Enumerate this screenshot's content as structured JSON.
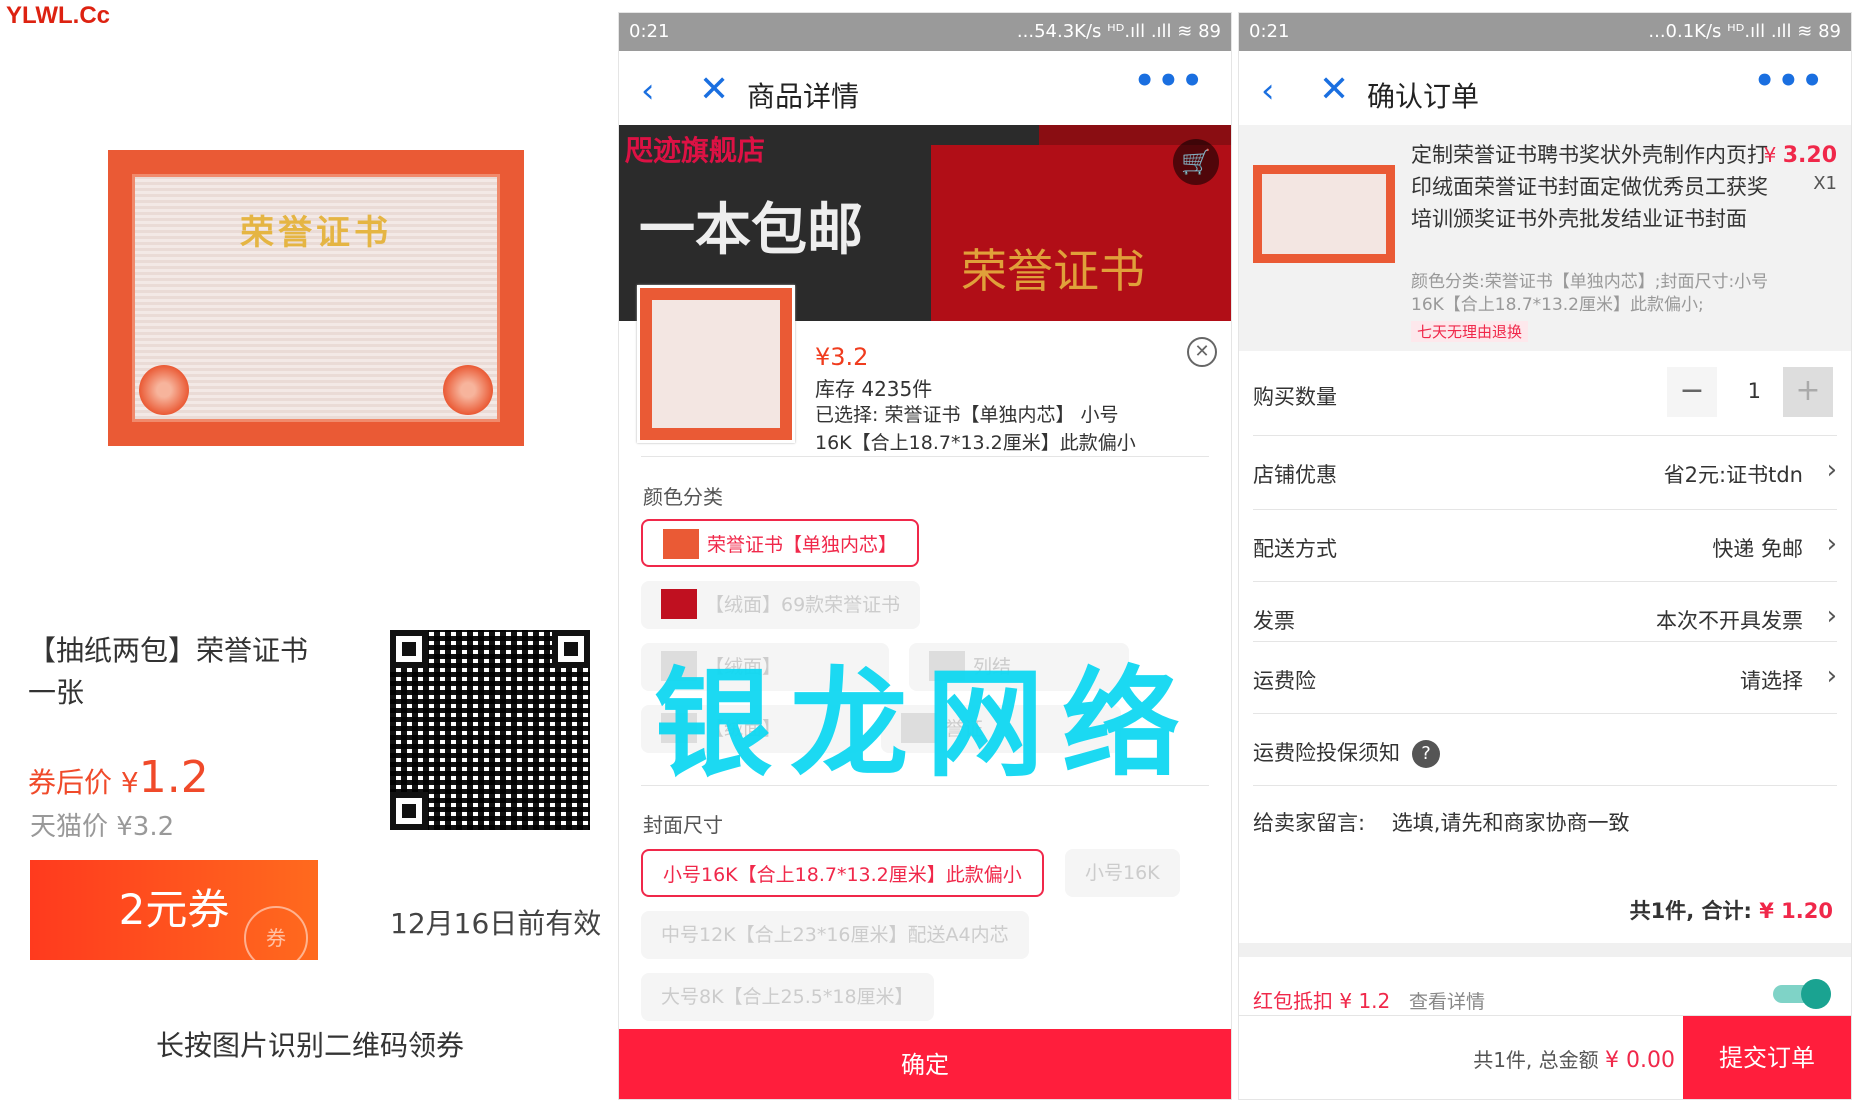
{
  "left": {
    "site_logo": "YLWL.Cc",
    "cert_title": "荣誉证书",
    "product_title": "【抽纸两包】荣誉证书一张",
    "after_price_label": "券后价 ¥",
    "after_price_value": "1.2",
    "tmall_price": "天猫价 ¥3.2",
    "coupon_label": "2元券",
    "coupon_stamp": "券",
    "valid_until": "12月16日前有效",
    "hint": "长按图片识别二维码领券"
  },
  "middle": {
    "status_time": "0:21",
    "status_right": "...54.3K/s ᴴᴰ.ıll .ıll ≋ 89",
    "nav_back": "‹",
    "nav_close": "✕",
    "nav_title": "商品详情",
    "nav_more": "•••",
    "banner_text1": "咫迹旗舰店",
    "banner_text2": "一本包邮",
    "banner_cert": "荣誉证书",
    "cart_icon": "🛒",
    "sku_price": "¥3.2",
    "sku_stock": "库存 4235件",
    "sku_selected": "已选择: 荣誉证书【单独内芯】 小号16K【合上18.7*13.2厘米】此款偏小",
    "sku_close": "✕",
    "color_section": "颜色分类",
    "color_options": [
      "荣誉证书【单独内芯】",
      "【绒面】69款荣誉证书",
      "【绒面】",
      "列结",
      "【绒面】",
      "誉证"
    ],
    "size_section": "封面尺寸",
    "size_options": [
      "小号16K【合上18.7*13.2厘米】此款偏小",
      "小号16K",
      "中号12K【合上23*16厘米】配送A4内芯",
      "大号8K【合上25.5*18厘米】"
    ],
    "confirm": "确定"
  },
  "right": {
    "status_time": "0:21",
    "status_right": "...0.1K/s ᴴᴰ.ıll .ıll ≋ 89",
    "nav_back": "‹",
    "nav_close": "✕",
    "nav_title": "确认订单",
    "nav_more": "•••",
    "item_title": "定制荣誉证书聘书奖状外壳制作内页打印绒面荣誉证书封面定做优秀员工获奖培训颁奖证书外壳批发结业证书封面",
    "item_price_symbol": "¥",
    "item_price": "3.20",
    "item_qty": "X1",
    "item_spec": "颜色分类:荣誉证书【单独内芯】;封面尺寸:小号16K【合上18.7*13.2厘米】此款偏小;",
    "item_badge": "七天无理由退换",
    "qty_label": "购买数量",
    "qty_minus": "−",
    "qty_value": "1",
    "qty_plus": "+",
    "shop_discount_label": "店铺优惠",
    "shop_discount_value": "省2元:证书tdn",
    "delivery_label": "配送方式",
    "delivery_value": "快递 免邮",
    "invoice_label": "发票",
    "invoice_value": "本次不开具发票",
    "freight_ins_label": "运费险",
    "freight_ins_value": "请选择",
    "freight_notice_label": "运费险投保须知",
    "help_icon": "?",
    "message_label": "给卖家留言:",
    "message_placeholder": "选填,请先和商家协商一致",
    "summary_prefix": "共1件, 合计:",
    "summary_amount": "¥ 1.20",
    "redpack_label": "红包抵扣 ¥ 1.2",
    "redpack_detail": "查看详情",
    "bottom_prefix": "共1件, 总金额",
    "bottom_amount": "¥ 0.00",
    "submit": "提交订单",
    "chevron": "›"
  },
  "watermark": "银龙网络"
}
